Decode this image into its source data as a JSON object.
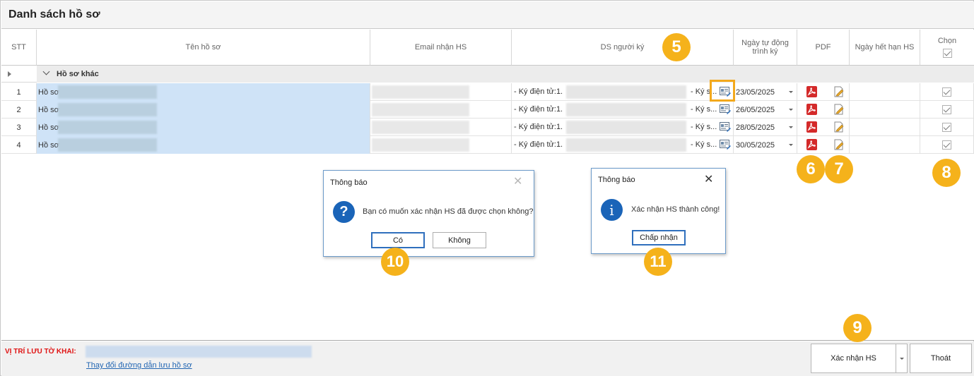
{
  "window": {
    "title": "Danh sách hồ sơ"
  },
  "columns": {
    "stt": "STT",
    "name": "Tên hồ sơ",
    "email": "Email nhận HS",
    "signers": "DS người ký",
    "auto_date_line1": "Ngày tự động",
    "auto_date_line2": "trình ký",
    "pdf": "PDF",
    "expire": "Ngày hết hạn HS",
    "select": "Chọn"
  },
  "group": {
    "label": "Hồ sơ khác"
  },
  "rows": [
    {
      "stt": "1",
      "name": "Hồ sơ",
      "sign_pre": "- Ký điện tử:1.",
      "sign_post": "- Ký s...",
      "date": "23/05/2025"
    },
    {
      "stt": "2",
      "name": "Hồ sơ",
      "sign_pre": "- Ký điện tử:1.",
      "sign_post": "- Ký s...",
      "date": "26/05/2025"
    },
    {
      "stt": "3",
      "name": "Hồ sơ",
      "sign_pre": "- Ký điện tử:1.",
      "sign_post": "- Ký s...",
      "date": "28/05/2025"
    },
    {
      "stt": "4",
      "name": "Hồ sơ",
      "sign_pre": "- Ký điện tử:1.",
      "sign_post": "- Ký s...",
      "date": "30/05/2025"
    }
  ],
  "dialog_confirm": {
    "title": "Thông báo",
    "message": "Bạn có muốn xác nhận HS đã được chọn không?",
    "yes": "Có",
    "no": "Không",
    "icon": "question-icon"
  },
  "dialog_success": {
    "title": "Thông báo",
    "message": "Xác nhận HS thành công!",
    "ok": "Chấp nhận",
    "icon": "info-icon"
  },
  "footer": {
    "location_label": "VỊ TRÍ LƯU TỜ KHAI:",
    "change_path_link": "Thay đổi đường dẫn lưu hồ sơ",
    "confirm_button": "Xác nhận HS",
    "exit_button": "Thoát"
  },
  "badges": [
    "5",
    "6",
    "7",
    "8",
    "9",
    "10",
    "11"
  ],
  "colors": {
    "badge": "#f5b21b",
    "selected_cell": "#cfe3f7",
    "location_label": "#e01414",
    "link": "#2266b3"
  }
}
